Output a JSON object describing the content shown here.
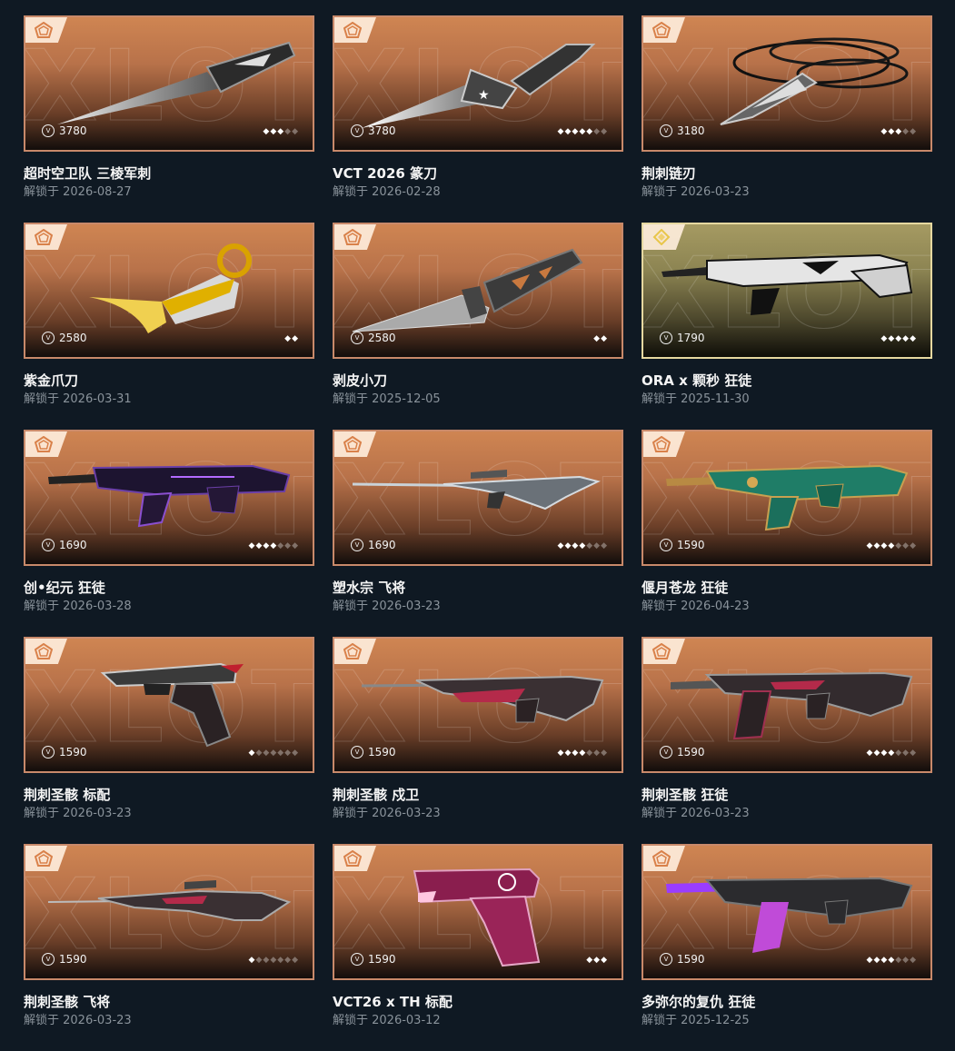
{
  "colors": {
    "background": "#0f1923",
    "card_border": "#c8896a",
    "card_border_ultra": "#e6d8a0",
    "title_text": "#f5f5f5",
    "date_text": "#8a939b"
  },
  "watermark_text": "XLOT",
  "currency_icon": "vp-icon",
  "items": [
    {
      "name": "超时空卫队 三棱军刺",
      "price": "3780",
      "rank_on": 3,
      "rank_total": 5,
      "date": "解锁于 2026-08-27",
      "tier_icon": "pentagon-tier-icon",
      "weapon": "knife"
    },
    {
      "name": "VCT 2026 篆刀",
      "price": "3780",
      "rank_on": 5,
      "rank_total": 7,
      "date": "解锁于 2026-02-28",
      "tier_icon": "pentagon-tier-icon",
      "weapon": "dagger"
    },
    {
      "name": "荆刺链刃",
      "price": "3180",
      "rank_on": 3,
      "rank_total": 5,
      "date": "解锁于 2026-03-23",
      "tier_icon": "pentagon-tier-icon",
      "weapon": "chainblade"
    },
    {
      "name": "紫金爪刀",
      "price": "2580",
      "rank_on": 2,
      "rank_total": 2,
      "date": "解锁于 2026-03-31",
      "tier_icon": "pentagon-tier-icon",
      "weapon": "karambit"
    },
    {
      "name": "剥皮小刀",
      "price": "2580",
      "rank_on": 2,
      "rank_total": 2,
      "date": "解锁于 2025-12-05",
      "tier_icon": "pentagon-tier-icon",
      "weapon": "bowie"
    },
    {
      "name": "ORA x 颗秒 狂徒",
      "price": "1790",
      "rank_on": 5,
      "rank_total": 5,
      "date": "解锁于 2025-11-30",
      "tier_icon": "diamond-tier-icon",
      "weapon": "rifle-white",
      "ultra": true
    },
    {
      "name": "创•纪元 狂徒",
      "price": "1690",
      "rank_on": 4,
      "rank_total": 7,
      "date": "解锁于 2026-03-28",
      "tier_icon": "pentagon-tier-icon",
      "weapon": "rifle-purple"
    },
    {
      "name": "塑水宗 飞将",
      "price": "1690",
      "rank_on": 4,
      "rank_total": 7,
      "date": "解锁于 2026-03-23",
      "tier_icon": "pentagon-tier-icon",
      "weapon": "sniper-silver"
    },
    {
      "name": "偃月苍龙 狂徒",
      "price": "1590",
      "rank_on": 4,
      "rank_total": 7,
      "date": "解锁于 2026-04-23",
      "tier_icon": "pentagon-tier-icon",
      "weapon": "rifle-jade"
    },
    {
      "name": "荆刺圣骸 标配",
      "price": "1590",
      "rank_on": 1,
      "rank_total": 7,
      "date": "解锁于 2026-03-23",
      "tier_icon": "pentagon-tier-icon",
      "weapon": "pistol-thorn"
    },
    {
      "name": "荆刺圣骸 戍卫",
      "price": "1590",
      "rank_on": 4,
      "rank_total": 7,
      "date": "解锁于 2026-03-23",
      "tier_icon": "pentagon-tier-icon",
      "weapon": "guardian-thorn"
    },
    {
      "name": "荆刺圣骸 狂徒",
      "price": "1590",
      "rank_on": 4,
      "rank_total": 7,
      "date": "解锁于 2026-03-23",
      "tier_icon": "pentagon-tier-icon",
      "weapon": "rifle-thorn"
    },
    {
      "name": "荆刺圣骸 飞将",
      "price": "1590",
      "rank_on": 1,
      "rank_total": 7,
      "date": "解锁于 2026-03-23",
      "tier_icon": "pentagon-tier-icon",
      "weapon": "sniper-thorn"
    },
    {
      "name": "VCT26 x TH 标配",
      "price": "1590",
      "rank_on": 3,
      "rank_total": 3,
      "date": "解锁于 2026-03-12",
      "tier_icon": "pentagon-tier-icon",
      "weapon": "pistol-pink"
    },
    {
      "name": "多弥尔的复仇 狂徒",
      "price": "1590",
      "rank_on": 4,
      "rank_total": 7,
      "date": "解锁于 2025-12-25",
      "tier_icon": "pentagon-tier-icon",
      "weapon": "rifle-dark"
    }
  ]
}
